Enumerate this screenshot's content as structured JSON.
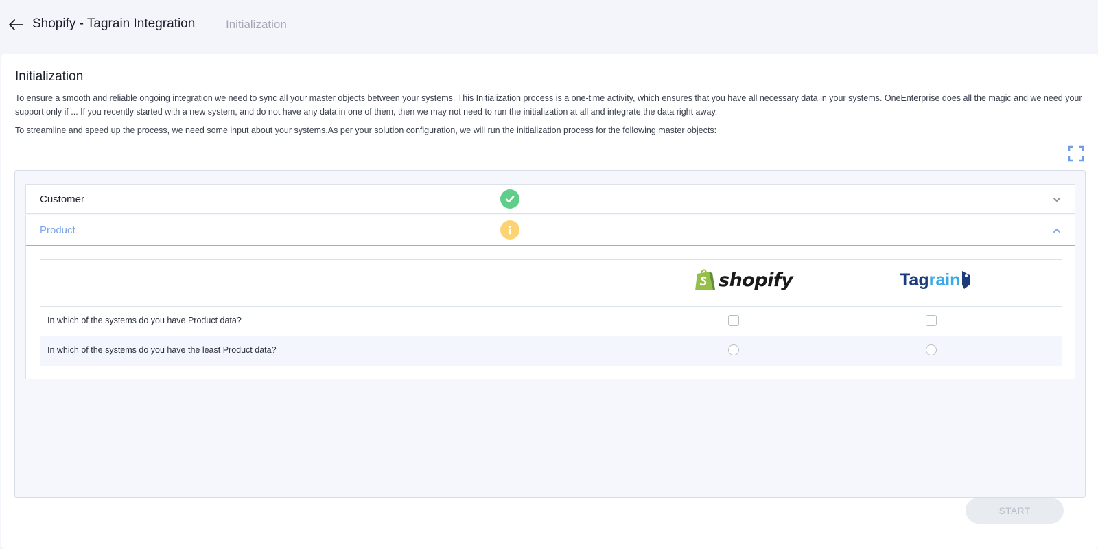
{
  "header": {
    "title": "Shopify - Tagrain Integration",
    "breadcrumb": "Initialization"
  },
  "main": {
    "section_title": "Initialization",
    "paragraph_1": "To ensure a smooth and reliable ongoing integration we need to sync all your master objects between your systems. This Initialization process is a one-time activity, which ensures that you have all necessary data in your systems. OneEnterprise does all the magic and we need your support only if ... If you recently started with a new system, and do not have any data in one of them, then we may not need to run the initialization at all and integrate the data right away.",
    "paragraph_2": "To streamline and speed up the process, we need some input about your systems.As per your solution configuration, we will run the initialization process for the following master objects:"
  },
  "accordion": [
    {
      "label": "Customer",
      "status": "complete",
      "status_icon": "check-icon",
      "expanded": false
    },
    {
      "label": "Product",
      "status": "info",
      "status_icon": "info-icon",
      "expanded": true
    }
  ],
  "systems": {
    "a": {
      "name": "shopify",
      "logo_color": "#95bf47"
    },
    "b": {
      "name_part_1": "Tag",
      "name_part_2": "rain"
    }
  },
  "questions": {
    "q1": "In which of the systems do you have Product data?",
    "q2": "In which of the systems do you have the least Product data?"
  },
  "actions": {
    "start_label": "START"
  },
  "colors": {
    "accent": "#7ea6e8",
    "success": "#5fce8a",
    "warning": "#fcd374"
  }
}
